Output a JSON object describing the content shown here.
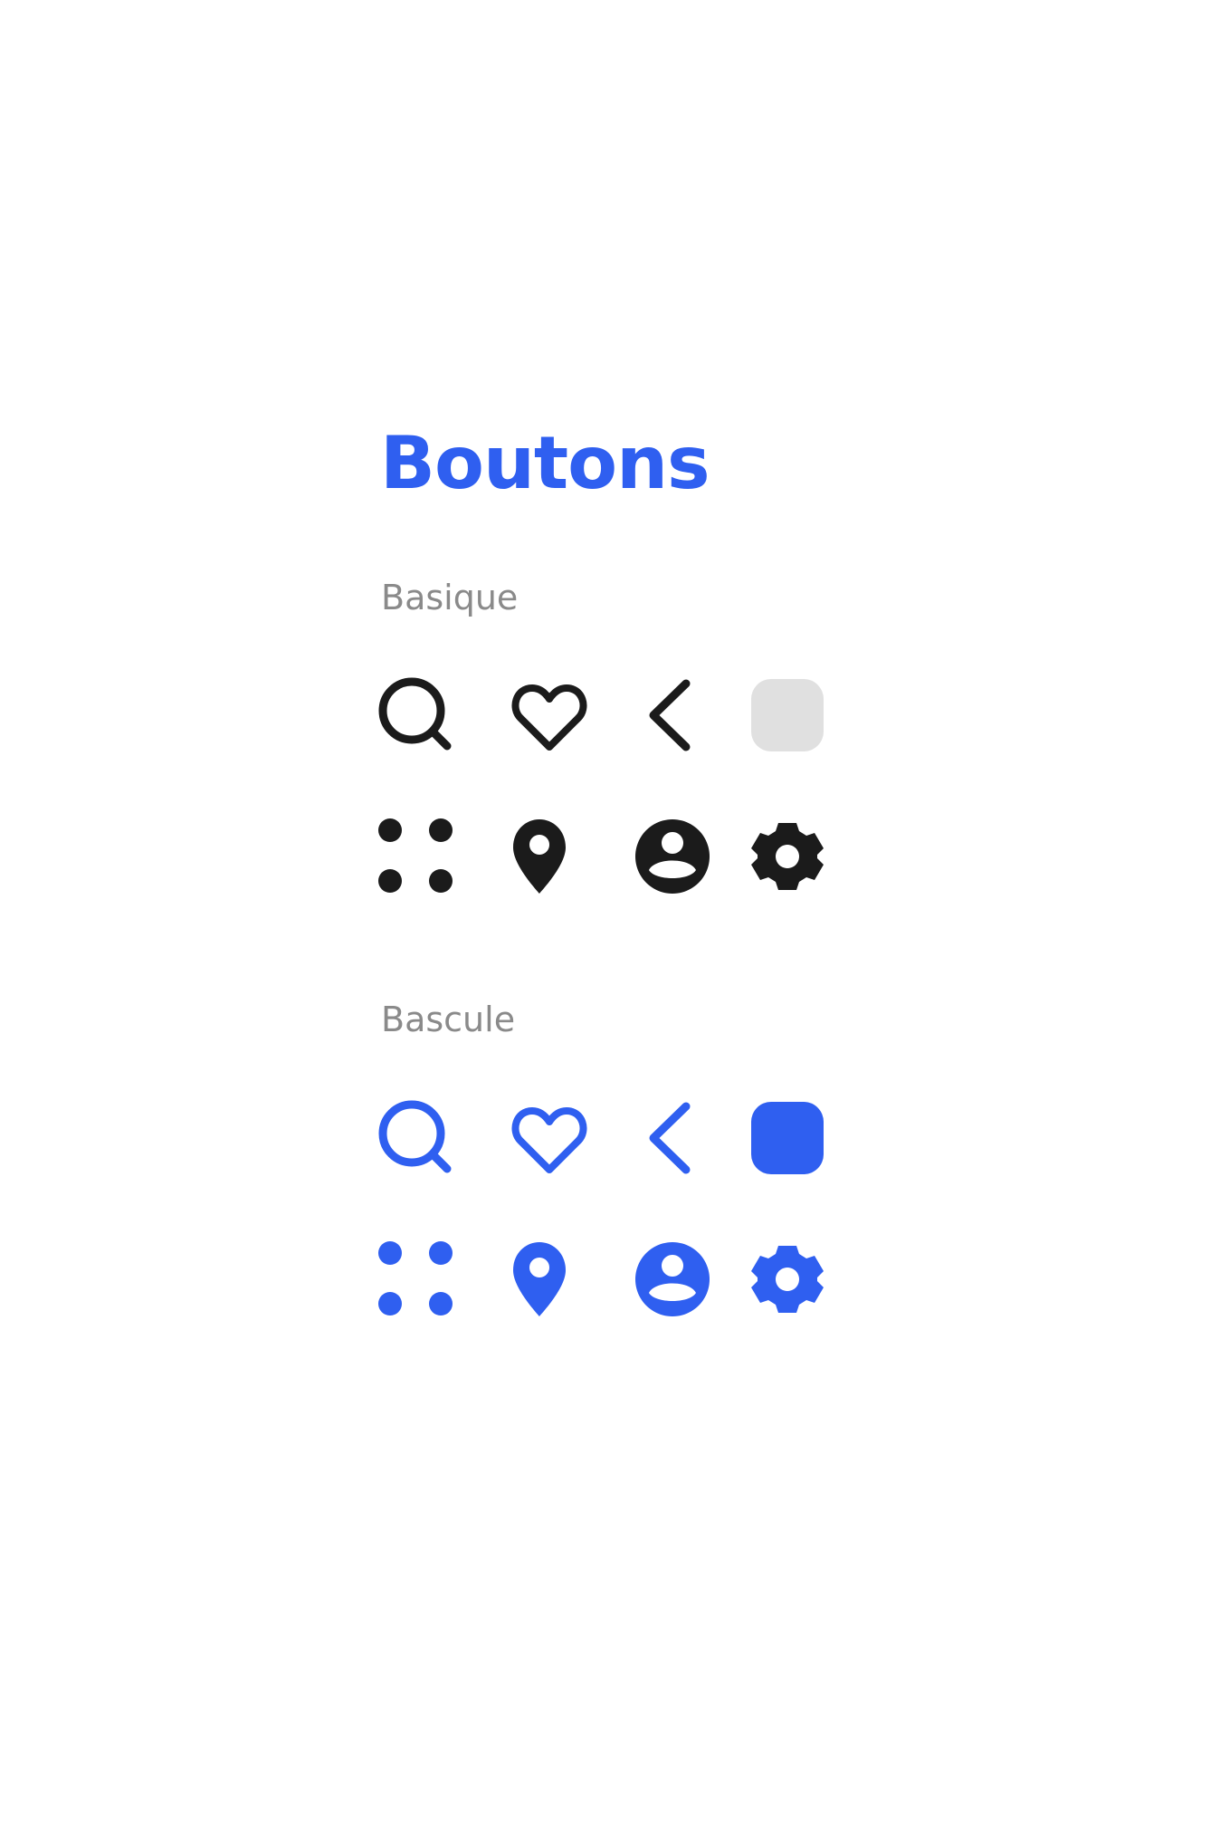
{
  "page": {
    "title": "Boutons"
  },
  "sections": [
    {
      "label": "Basique",
      "variant": "basic",
      "icon_color": "#1b1b1b",
      "square_color": "#e0e0e0",
      "icons": [
        "search-icon",
        "heart-icon",
        "chevron-left-icon",
        "rounded-square-icon",
        "grid-dots-icon",
        "location-pin-icon",
        "user-circle-icon",
        "gear-icon"
      ]
    },
    {
      "label": "Bascule",
      "variant": "toggle",
      "icon_color": "#2f5ff0",
      "square_color": "#2f5ff0",
      "icons": [
        "search-icon",
        "heart-icon",
        "chevron-left-icon",
        "rounded-square-icon",
        "grid-dots-icon",
        "location-pin-icon",
        "user-circle-icon",
        "gear-icon"
      ]
    }
  ],
  "colors": {
    "accent": "#2f5ff0",
    "label_gray": "#8a8a8a",
    "icon_dark": "#1b1b1b",
    "square_light": "#e0e0e0",
    "background": "#ffffff"
  }
}
